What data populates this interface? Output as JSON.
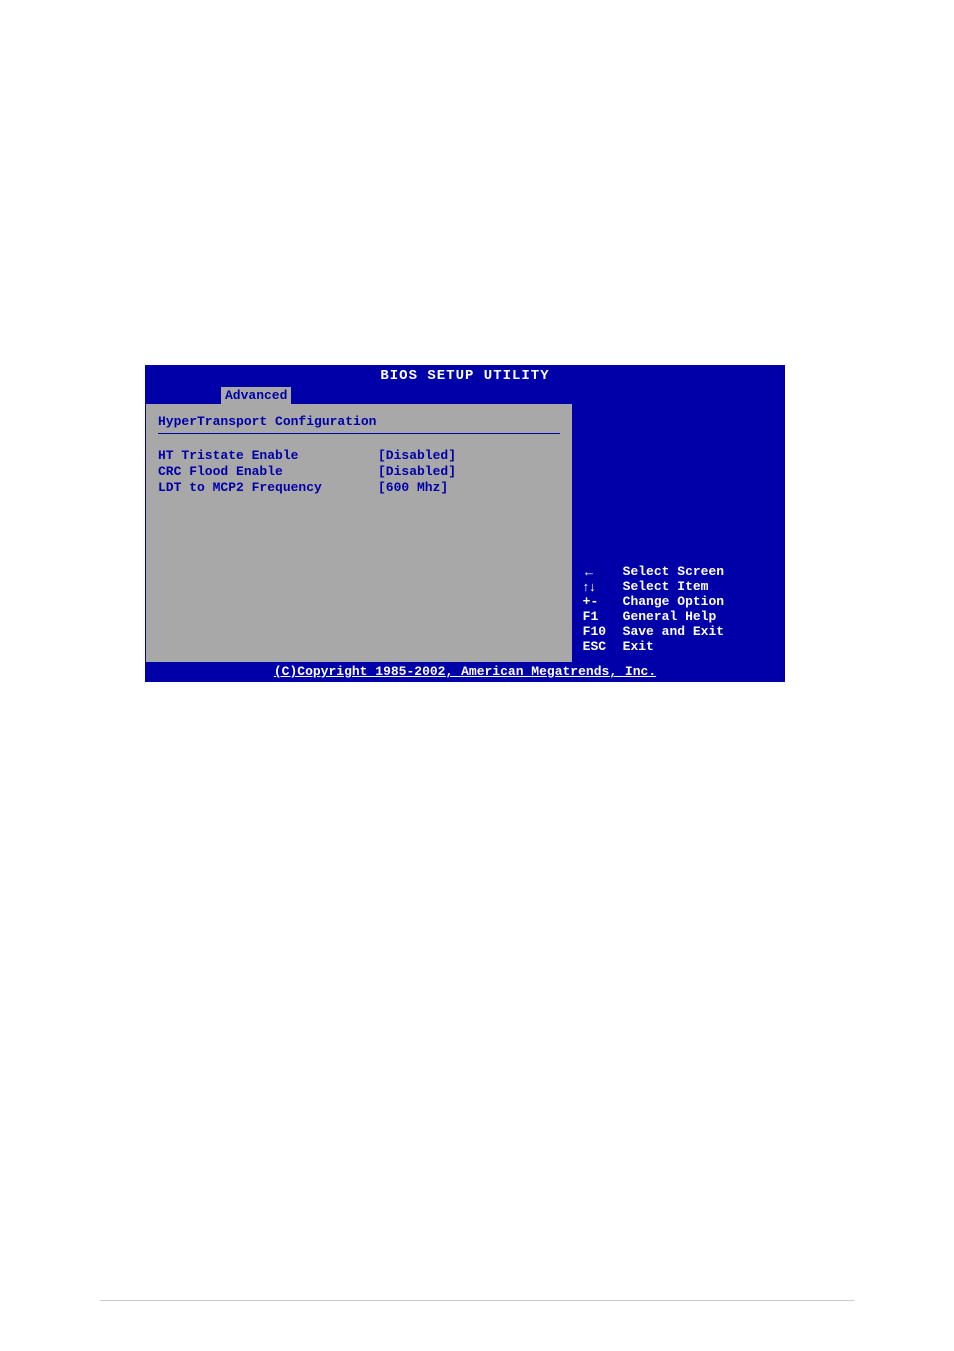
{
  "header": {
    "title": "BIOS SETUP UTILITY",
    "active_tab": "Advanced"
  },
  "section": {
    "title": "HyperTransport Configuration",
    "options": [
      {
        "label": "HT Tristate Enable",
        "value": "[Disabled]"
      },
      {
        "label": "CRC Flood Enable",
        "value": "[Disabled]"
      },
      {
        "label": "LDT to MCP2 Frequency",
        "value": "[600 Mhz]"
      }
    ]
  },
  "help": [
    {
      "key": "←",
      "desc": "Select Screen"
    },
    {
      "key": "↑↓",
      "desc": "Select Item"
    },
    {
      "key": "+-",
      "desc": "Change Option"
    },
    {
      "key": "F1",
      "desc": "General Help"
    },
    {
      "key": "F10",
      "desc": "Save and Exit"
    },
    {
      "key": "ESC",
      "desc": "Exit"
    }
  ],
  "footer": "(C)Copyright 1985-2002, American Megatrends, Inc."
}
